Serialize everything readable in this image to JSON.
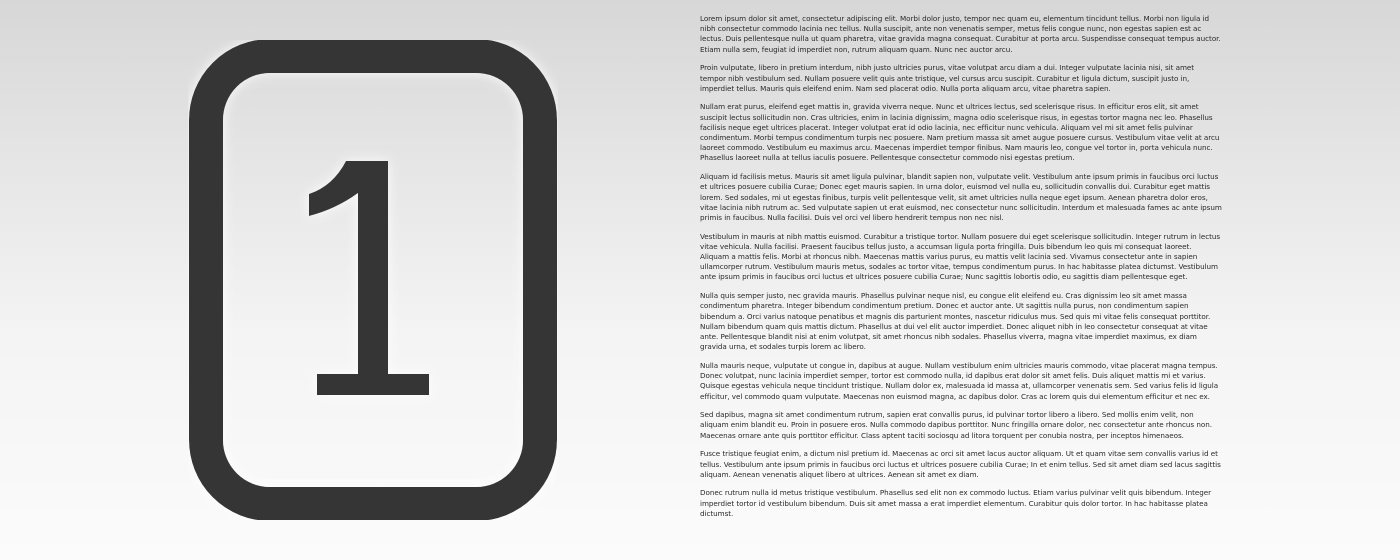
{
  "badge": {
    "numeral": "1"
  },
  "colors": {
    "badge": "#353535",
    "text": "#2a2a2a"
  },
  "paragraphs": [
    "Lorem ipsum dolor sit amet, consectetur adipiscing elit. Morbi dolor justo, tempor nec quam eu, elementum tincidunt tellus. Morbi non ligula id nibh consectetur commodo lacinia nec tellus. Nulla suscipit, ante non venenatis semper, metus felis congue nunc, non egestas sapien est ac lectus. Duis pellentesque nulla ut quam pharetra, vitae gravida magna consequat. Curabitur at porta arcu. Suspendisse consequat tempus auctor. Etiam nulla sem, feugiat id imperdiet non, rutrum aliquam quam. Nunc nec auctor arcu.",
    "Proin vulputate, libero in pretium interdum, nibh justo ultricies purus, vitae volutpat arcu diam a dui. Integer vulputate lacinia nisi, sit amet tempor nibh vestibulum sed. Nullam posuere velit quis ante tristique, vel cursus arcu suscipit. Curabitur et ligula dictum, suscipit justo in, imperdiet tellus. Mauris quis eleifend enim. Nam sed placerat odio. Nulla porta aliquam arcu, vitae pharetra sapien.",
    "Nullam erat purus, eleifend eget mattis in, gravida viverra neque. Nunc et ultrices lectus, sed scelerisque risus. In efficitur eros elit, sit amet suscipit lectus sollicitudin non. Cras ultricies, enim in lacinia dignissim, magna odio scelerisque risus, in egestas tortor magna nec leo. Phasellus facilisis neque eget ultrices placerat. Integer volutpat erat id odio lacinia, nec efficitur nunc vehicula. Aliquam vel mi sit amet felis pulvinar condimentum. Morbi tempus condimentum turpis nec posuere. Nam pretium massa sit amet augue posuere cursus. Vestibulum vitae velit at arcu laoreet commodo. Vestibulum eu maximus arcu. Maecenas imperdiet tempor finibus. Nam mauris leo, congue vel tortor in, porta vehicula nunc. Phasellus laoreet nulla at tellus iaculis posuere. Pellentesque consectetur commodo nisi egestas pretium.",
    "Aliquam id facilisis metus. Mauris sit amet ligula pulvinar, blandit sapien non, vulputate velit. Vestibulum ante ipsum primis in faucibus orci luctus et ultrices posuere cubilia Curae; Donec eget mauris sapien. In urna dolor, euismod vel nulla eu, sollicitudin convallis dui. Curabitur eget mattis lorem. Sed sodales, mi ut egestas finibus, turpis velit pellentesque velit, sit amet ultricies nulla neque eget ipsum. Aenean pharetra dolor eros, vitae lacinia nibh rutrum ac. Sed vulputate sapien ut erat euismod, nec consectetur nunc sollicitudin. Interdum et malesuada fames ac ante ipsum primis in faucibus. Nulla facilisi. Duis vel orci vel libero hendrerit tempus non nec nisl.",
    "Vestibulum in mauris at nibh mattis euismod. Curabitur a tristique tortor. Nullam posuere dui eget scelerisque sollicitudin. Integer rutrum in lectus vitae vehicula. Nulla facilisi. Praesent faucibus tellus justo, a accumsan ligula porta fringilla. Duis bibendum leo quis mi consequat laoreet. Aliquam a mattis felis. Morbi at rhoncus nibh. Maecenas mattis varius purus, eu mattis velit lacinia sed. Vivamus consectetur ante in sapien ullamcorper rutrum. Vestibulum mauris metus, sodales ac tortor vitae, tempus condimentum purus. In hac habitasse platea dictumst. Vestibulum ante ipsum primis in faucibus orci luctus et ultrices posuere cubilia Curae; Nunc sagittis lobortis odio, eu sagittis diam pellentesque eget.",
    "Nulla quis semper justo, nec gravida mauris. Phasellus pulvinar neque nisl, eu congue elit eleifend eu. Cras dignissim leo sit amet massa condimentum pharetra. Integer bibendum condimentum pretium. Donec et auctor ante. Ut sagittis nulla purus, non condimentum sapien bibendum a. Orci varius natoque penatibus et magnis dis parturient montes, nascetur ridiculus mus. Sed quis mi vitae felis consequat porttitor. Nullam bibendum quam quis mattis dictum. Phasellus at dui vel elit auctor imperdiet. Donec aliquet nibh in leo consectetur consequat at vitae ante. Pellentesque blandit nisi at enim volutpat, sit amet rhoncus nibh sodales. Phasellus viverra, magna vitae imperdiet maximus, ex diam gravida urna, et sodales turpis lorem ac libero.",
    "Nulla mauris neque, vulputate ut congue in, dapibus at augue. Nullam vestibulum enim ultricies mauris commodo, vitae placerat magna tempus. Donec volutpat, nunc lacinia imperdiet semper, tortor est commodo nulla, id dapibus erat dolor sit amet felis. Duis aliquet mattis mi et varius. Quisque egestas vehicula neque tincidunt tristique. Nullam dolor ex, malesuada id massa at, ullamcorper venenatis sem. Sed varius felis id ligula efficitur, vel commodo quam vulputate. Maecenas non euismod magna, ac dapibus dolor. Cras ac lorem quis dui elementum efficitur et nec ex.",
    "Sed dapibus, magna sit amet condimentum rutrum, sapien erat convallis purus, id pulvinar tortor libero a libero. Sed mollis enim velit, non aliquam enim blandit eu. Proin in posuere eros. Nulla commodo dapibus porttitor. Nunc fringilla ornare dolor, nec consectetur ante rhoncus non. Maecenas ornare ante quis porttitor efficitur. Class aptent taciti sociosqu ad litora torquent per conubia nostra, per inceptos himenaeos.",
    "Fusce tristique feugiat enim, a dictum nisl pretium id. Maecenas ac orci sit amet lacus auctor aliquam. Ut et quam vitae sem convallis varius id et tellus. Vestibulum ante ipsum primis in faucibus orci luctus et ultrices posuere cubilia Curae; In et enim tellus. Sed sit amet diam sed lacus sagittis aliquam. Aenean venenatis aliquet libero at ultrices. Aenean sit amet ex diam.",
    "Donec rutrum nulla id metus tristique vestibulum. Phasellus sed elit non ex commodo luctus. Etiam varius pulvinar velit quis bibendum. Integer imperdiet tortor id vestibulum bibendum. Duis sit amet massa a erat imperdiet elementum. Curabitur quis dolor tortor. In hac habitasse platea dictumst."
  ]
}
